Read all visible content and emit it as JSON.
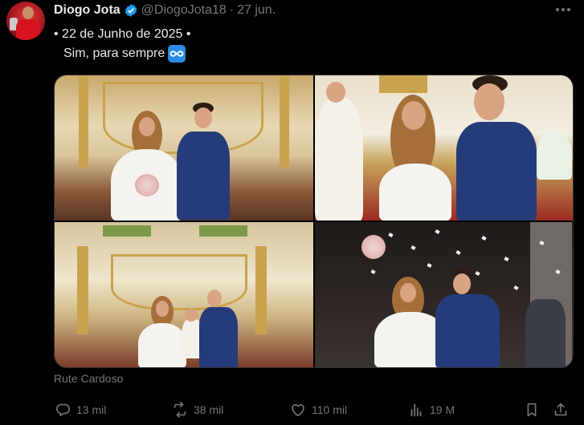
{
  "tweet": {
    "author_name": "Diogo Jota",
    "handle": "@DiogoJota18",
    "separator": "·",
    "date": "27 jun.",
    "text_line1": "• 22 de Junho de 2025 •",
    "text_line2": "Sim, para sempre",
    "emoji": "infinity-emoji",
    "photo_credit": "Rute Cardoso",
    "photos": [
      {
        "name": "photo-couple-at-altar"
      },
      {
        "name": "photo-couple-showing-rings"
      },
      {
        "name": "photo-couple-with-child-at-altar"
      },
      {
        "name": "photo-couple-leaving-church-confetti"
      }
    ]
  },
  "actions": {
    "replies": "13 mil",
    "retweets": "38 mil",
    "likes": "110 mil",
    "views": "19 M"
  },
  "colors": {
    "background": "#000000",
    "text_primary": "#e7e9ea",
    "text_secondary": "#71767b",
    "verified_blue": "#1d9bf0"
  }
}
